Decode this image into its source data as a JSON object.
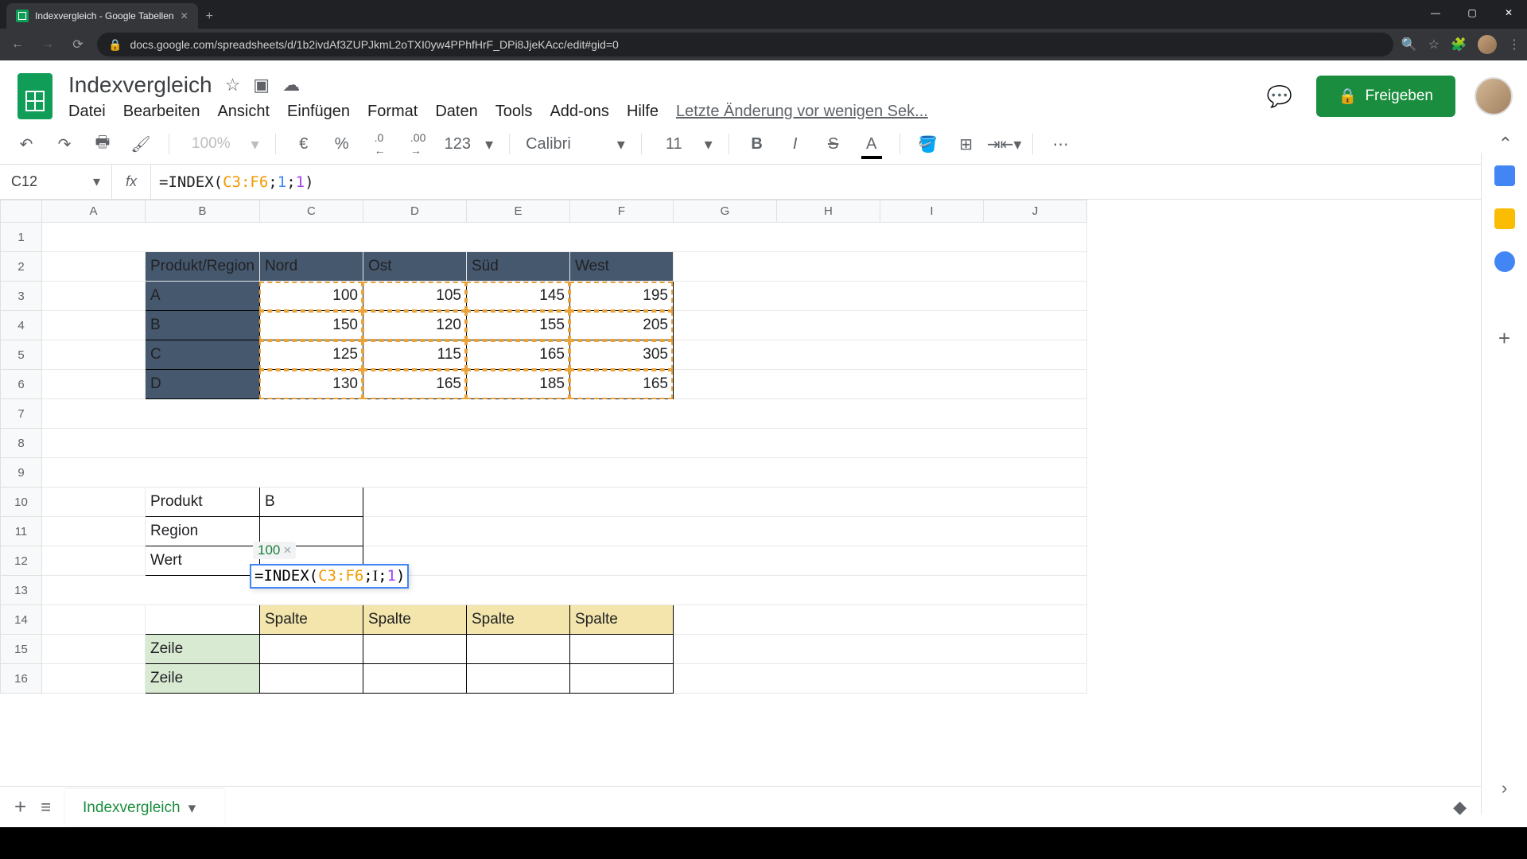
{
  "browser": {
    "tab_title": "Indexvergleich - Google Tabellen",
    "url": "docs.google.com/spreadsheets/d/1b2ivdAf3ZUPJkmL2oTXI0yw4PPhfHrF_DPi8JjeKAcc/edit#gid=0"
  },
  "doc": {
    "title": "Indexvergleich",
    "last_edit": "Letzte Änderung vor wenigen Sek...",
    "share_label": "Freigeben"
  },
  "menu": [
    "Datei",
    "Bearbeiten",
    "Ansicht",
    "Einfügen",
    "Format",
    "Daten",
    "Tools",
    "Add-ons",
    "Hilfe"
  ],
  "toolbar": {
    "zoom": "100%",
    "currency": "€",
    "percent": "%",
    "dec_dec": ".0",
    "inc_dec": ".00",
    "numfmt": "123",
    "font": "Calibri",
    "font_size": "11"
  },
  "formula_bar": {
    "name_box": "C12",
    "formula_prefix": "=INDEX(",
    "formula_range": "C3:F6",
    "formula_sep1": ";",
    "formula_arg2": "1",
    "formula_sep2": ";",
    "formula_arg3": "1",
    "formula_suffix": ")"
  },
  "cell_editor": {
    "hint_value": "100",
    "text_prefix": "=INDEX(",
    "text_range": "C3:F6",
    "text_sep1": ";",
    "cursor": "I",
    "text_sep2": ";",
    "text_arg3": "1",
    "text_suffix": ")"
  },
  "columns": [
    "A",
    "B",
    "C",
    "D",
    "E",
    "F",
    "G",
    "H",
    "I",
    "J"
  ],
  "rows": [
    "1",
    "2",
    "3",
    "4",
    "5",
    "6",
    "7",
    "8",
    "9",
    "10",
    "11",
    "12",
    "13",
    "14",
    "15",
    "16"
  ],
  "table1": {
    "corner": "Produkt/Region",
    "cols": [
      "Nord",
      "Ost",
      "Süd",
      "West"
    ],
    "rows": [
      "A",
      "B",
      "C",
      "D"
    ],
    "data": [
      [
        100,
        105,
        145,
        195
      ],
      [
        150,
        120,
        155,
        205
      ],
      [
        125,
        115,
        165,
        305
      ],
      [
        130,
        165,
        185,
        165
      ]
    ]
  },
  "lookup": {
    "produkt_label": "Produkt",
    "produkt_value": "B",
    "region_label": "Region",
    "wert_label": "Wert"
  },
  "table2": {
    "spalte": "Spalte",
    "zeile": "Zeile"
  },
  "sheet_tab": "Indexvergleich"
}
